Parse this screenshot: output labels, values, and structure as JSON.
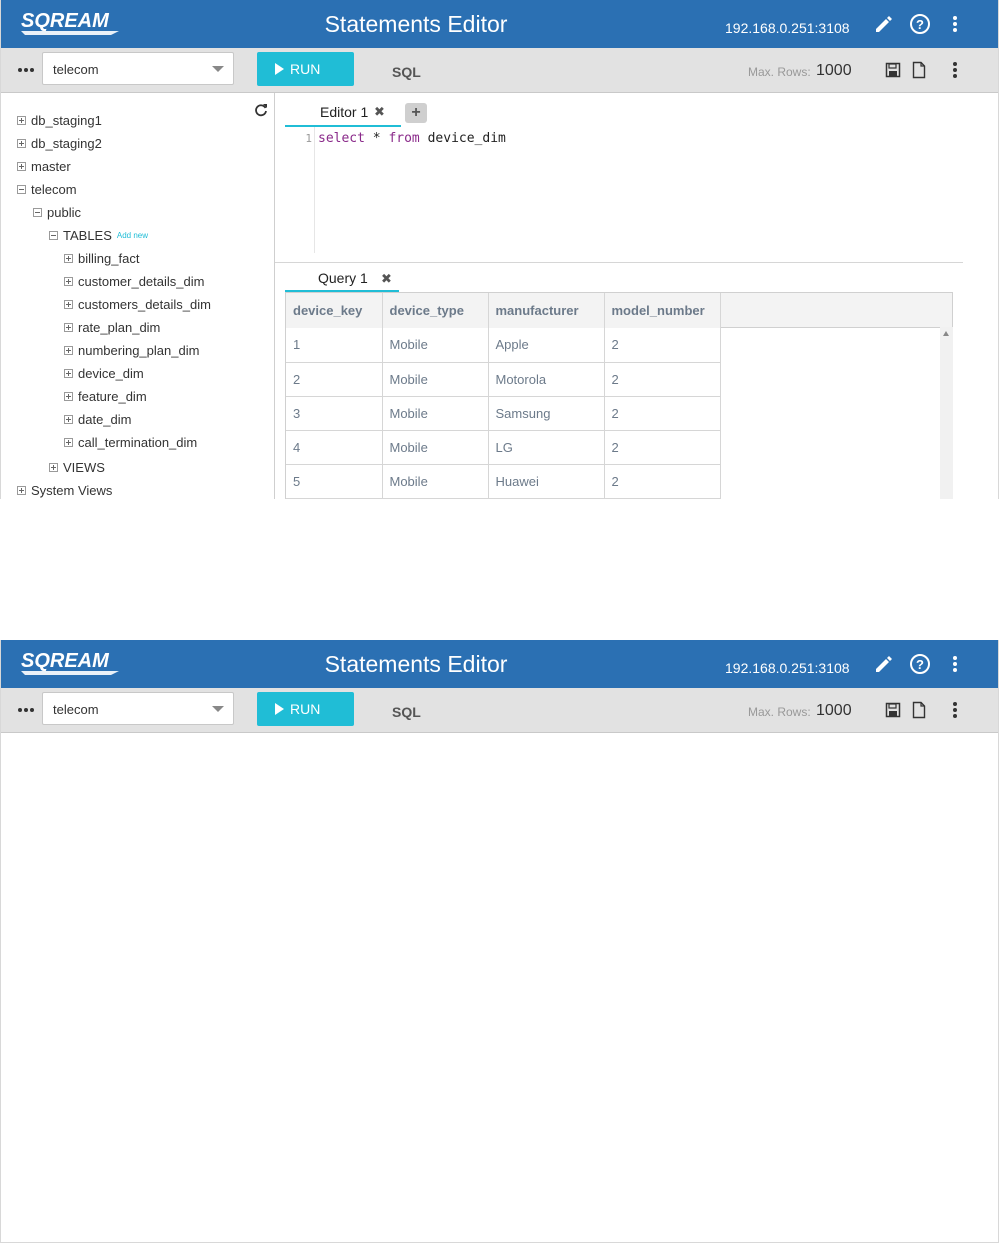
{
  "header": {
    "brand": "SQREAM",
    "title": "Statements Editor",
    "connection": "192.168.0.251:3108"
  },
  "toolbar": {
    "database": "telecom",
    "run_label": "RUN",
    "mode_label": "SQL",
    "max_rows_label": "Max. Rows:",
    "max_rows_value": "1000"
  },
  "tree": {
    "databases": [
      "db_staging1",
      "db_staging2",
      "master",
      "telecom"
    ],
    "schema": "public",
    "tables_label": "TABLES",
    "add_new": "Add new",
    "tables": [
      "billing_fact",
      "customer_details_dim",
      "customers_details_dim",
      "rate_plan_dim",
      "numbering_plan_dim",
      "device_dim",
      "feature_dim",
      "date_dim",
      "call_termination_dim"
    ],
    "views_label": "VIEWS",
    "system_views": "System Views"
  },
  "editor": {
    "tab_label": "Editor 1",
    "line_number": "1",
    "code_kw1": "select",
    "code_mid": " * ",
    "code_kw2": "from",
    "code_tail": " device_dim"
  },
  "results": {
    "tab_label": "Query 1",
    "columns": [
      "device_key",
      "device_type",
      "manufacturer",
      "model_number"
    ],
    "rows": [
      [
        "1",
        "Mobile",
        "Apple",
        "2"
      ],
      [
        "2",
        "Mobile",
        "Motorola",
        "2"
      ],
      [
        "3",
        "Mobile",
        "Samsung",
        "2"
      ],
      [
        "4",
        "Mobile",
        "LG",
        "2"
      ],
      [
        "5",
        "Mobile",
        "Huawei",
        "2"
      ]
    ]
  }
}
